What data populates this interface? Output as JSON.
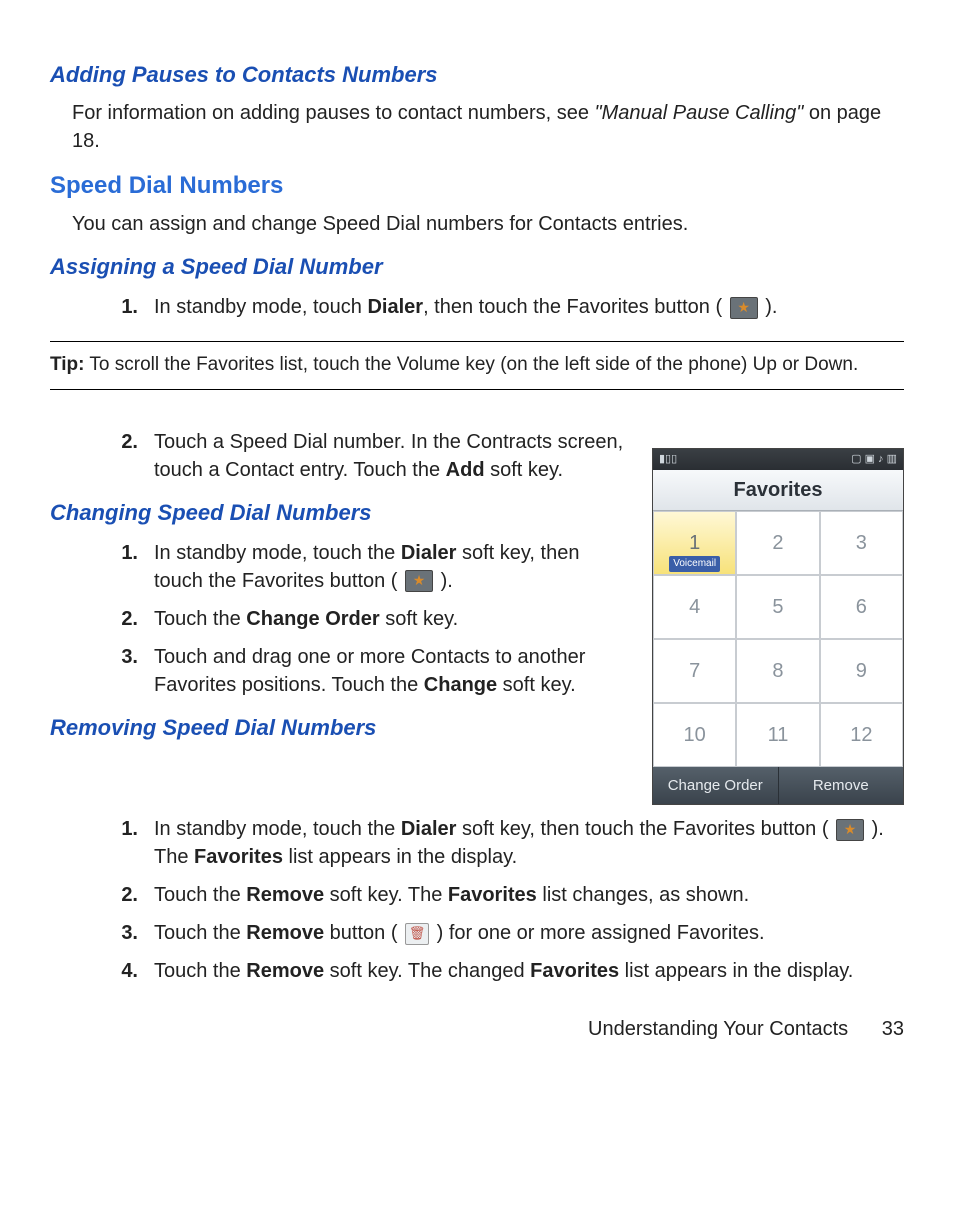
{
  "headings": {
    "adding_pauses": "Adding Pauses to Contacts Numbers",
    "speed_dial": "Speed Dial Numbers",
    "assigning": "Assigning a Speed Dial Number",
    "changing": "Changing Speed Dial Numbers",
    "removing": "Removing Speed Dial Numbers"
  },
  "paragraphs": {
    "adding_pauses_pre": "For information on adding pauses to contact numbers, see ",
    "adding_pauses_ref": "\"Manual Pause Calling\"",
    "adding_pauses_post": " on page 18.",
    "speed_dial_intro": "You can assign and change Speed Dial numbers for Contacts entries."
  },
  "assign_steps": {
    "s1_a": "In standby mode, touch ",
    "s1_bold": "Dialer",
    "s1_b": ", then touch the Favorites button ( ",
    "s1_c": " ).",
    "s2_a": "Touch a Speed Dial number. In the Contracts screen, touch a Contact entry. Touch the ",
    "s2_bold": "Add",
    "s2_b": " soft key."
  },
  "tip": {
    "label": "Tip:",
    "text": " To scroll the Favorites list, touch the Volume key (on the left side of the phone) Up or Down."
  },
  "change_steps": {
    "s1_a": "In standby mode, touch the ",
    "s1_bold": "Dialer",
    "s1_b": " soft key, then touch the Favorites button ( ",
    "s1_c": " ).",
    "s2_a": "Touch the ",
    "s2_bold": "Change Order",
    "s2_b": " soft key.",
    "s3_a": "Touch and drag one or more Contacts to another Favorites positions. Touch the ",
    "s3_bold": "Change",
    "s3_b": " soft key."
  },
  "remove_steps": {
    "s1_a": "In standby mode, touch the ",
    "s1_bold": "Dialer",
    "s1_b": " soft key, then touch the Favorites button ( ",
    "s1_c": " ). The ",
    "s1_bold2": "Favorites",
    "s1_d": " list appears in the display.",
    "s2_a": "Touch the ",
    "s2_bold": "Remove",
    "s2_b": " soft key. The ",
    "s2_bold2": "Favorites",
    "s2_c": " list changes, as shown.",
    "s3_a": "Touch the ",
    "s3_bold": "Remove",
    "s3_b": " button ( ",
    "s3_c": " ) for one or more assigned Favorites.",
    "s4_a": "Touch the ",
    "s4_bold": "Remove",
    "s4_b": " soft key. The changed ",
    "s4_bold2": "Favorites",
    "s4_c": " list appears in the display."
  },
  "phone": {
    "status_left": "▮▯▯",
    "status_right": "▢ ▣ ♪ ▥",
    "title": "Favorites",
    "cells": [
      {
        "n": "1",
        "label": "Voicemail",
        "selected": true
      },
      {
        "n": "2"
      },
      {
        "n": "3"
      },
      {
        "n": "4"
      },
      {
        "n": "5"
      },
      {
        "n": "6"
      },
      {
        "n": "7"
      },
      {
        "n": "8"
      },
      {
        "n": "9"
      },
      {
        "n": "10"
      },
      {
        "n": "11"
      },
      {
        "n": "12"
      }
    ],
    "softkey_left": "Change Order",
    "softkey_right": "Remove"
  },
  "footer": {
    "text": "Understanding Your Contacts",
    "page": "33"
  },
  "nums": {
    "n1": "1.",
    "n2": "2.",
    "n3": "3.",
    "n4": "4."
  }
}
